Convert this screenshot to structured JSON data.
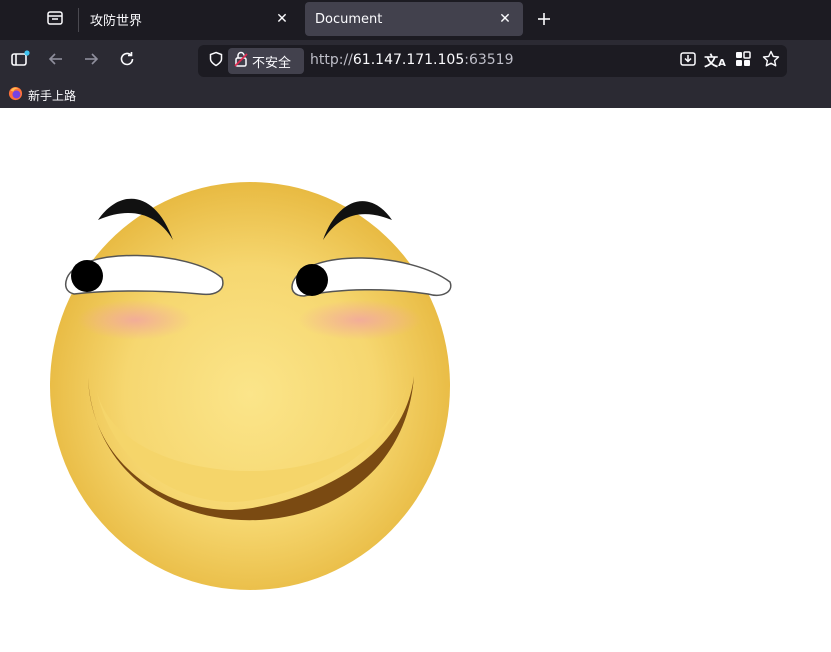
{
  "tabs": [
    {
      "title": "攻防世界",
      "active": false
    },
    {
      "title": "Document",
      "active": true
    }
  ],
  "address_bar": {
    "security_label": "不安全",
    "url_scheme": "http://",
    "url_host": "61.147.171.105",
    "url_port": ":63519"
  },
  "bookmarks": [
    {
      "label": "新手上路",
      "icon": "firefox-icon"
    }
  ],
  "icons": {
    "tab_list": "tab-list-icon",
    "tab_close": "close-icon",
    "new_tab": "plus-icon",
    "sidebar": "sidebar-icon",
    "back": "back-arrow-icon",
    "forward": "forward-arrow-icon",
    "reload": "reload-icon",
    "shield": "shield-icon",
    "insecure": "insecure-lock-icon",
    "save": "save-to-pocket-icon",
    "translate": "translate-icon",
    "extensions": "extensions-icon",
    "bookmark_star": "star-icon"
  },
  "colors": {
    "tabstrip_bg": "#1c1b22",
    "toolbar_bg": "#2b2a33",
    "active_tab_bg": "#42414d",
    "page_bg": "#ffffff",
    "face_yellow": "#f5d56a",
    "blush": "#f2a6a0",
    "mouth": "#7a4a12"
  }
}
